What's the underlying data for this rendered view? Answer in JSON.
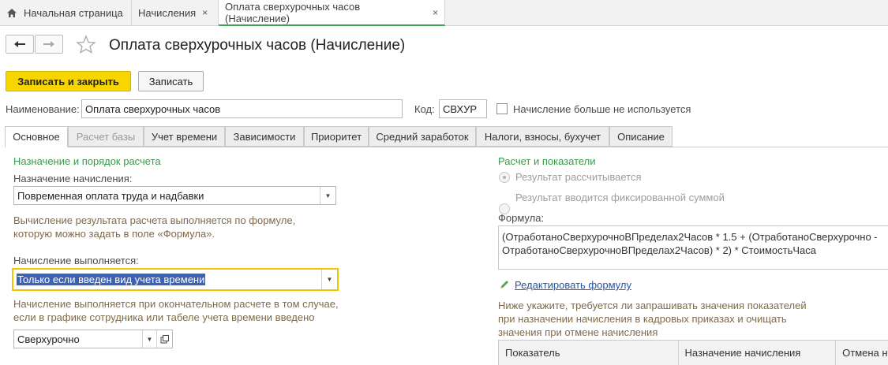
{
  "tabs": [
    {
      "label": "Начальная страница"
    },
    {
      "label": "Начисления",
      "close": "×"
    },
    {
      "label": "Оплата сверхурочных часов (Начисление)",
      "close": "×"
    }
  ],
  "header": {
    "title": "Оплата сверхурочных часов (Начисление)"
  },
  "toolbar": {
    "save_close": "Записать и закрыть",
    "save": "Записать"
  },
  "fields": {
    "name_label": "Наименование:",
    "name_value": "Оплата сверхурочных часов",
    "code_label": "Код:",
    "code_value": "СВХУР",
    "unused_label": "Начисление больше не используется"
  },
  "form_tabs": [
    {
      "label": "Основное"
    },
    {
      "label": "Расчет базы"
    },
    {
      "label": "Учет времени"
    },
    {
      "label": "Зависимости"
    },
    {
      "label": "Приоритет"
    },
    {
      "label": "Средний заработок"
    },
    {
      "label": "Налоги, взносы, бухучет"
    },
    {
      "label": "Описание"
    }
  ],
  "left": {
    "section_title": "Назначение и порядок расчета",
    "purpose_label": "Назначение начисления:",
    "purpose_value": "Повременная оплата труда и надбавки",
    "hint1_line1": "Вычисление результата расчета выполняется по формуле,",
    "hint1_line2": "которую можно задать в поле «Формула».",
    "exec_label": "Начисление выполняется:",
    "exec_value": "Только если введен вид учета времени",
    "hint2_line1": "Начисление выполняется при окончательном расчете в том случае,",
    "hint2_line2": "если в графике сотрудника или табеле учета времени введено",
    "time_kind_value": "Сверхурочно"
  },
  "right": {
    "section_title": "Расчет и показатели",
    "radio1": "Результат рассчитывается",
    "radio2": "Результат вводится фиксированной суммой",
    "formula_label": "Формула:",
    "formula_line1": "(ОтработаноСверхурочноВПределах2Часов * 1.5 + (ОтработаноСверхурочно -",
    "formula_line2": "ОтработаноСверхурочноВПределах2Часов) * 2) * СтоимостьЧаса",
    "edit_formula": "Редактировать формулу",
    "hint_line1": "Ниже укажите, требуется ли запрашивать значения показателей",
    "hint_line2": "при назначении начисления в кадровых приказах и очищать",
    "hint_line3": "значения при отмене начисления",
    "columns": [
      "Показатель",
      "Назначение начисления",
      "Отмена на"
    ]
  },
  "colors": {
    "accent_yellow": "#f7d600",
    "active_tab_underline": "#3aa655",
    "section_green": "#3a9a4c",
    "link_blue": "#2754a8",
    "selection_blue": "#3b62b8"
  }
}
